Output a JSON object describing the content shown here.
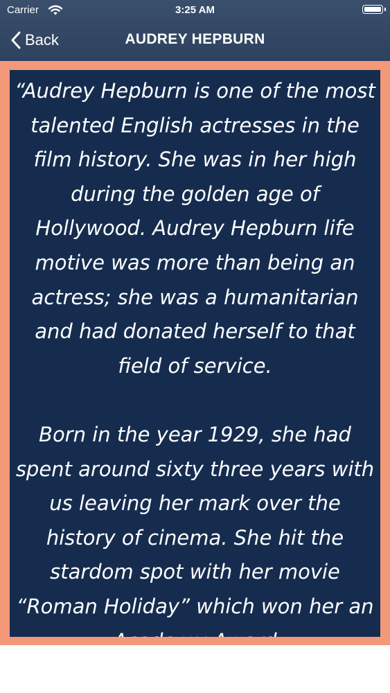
{
  "status_bar": {
    "carrier": "Carrier",
    "time": "3:25 AM",
    "wifi_icon": "wifi-icon",
    "battery_icon": "battery-icon"
  },
  "nav": {
    "back_label": "Back",
    "back_icon": "chevron-left-icon",
    "title": "AUDREY HEPBURN"
  },
  "colors": {
    "nav_bar": "#344966",
    "frame": "#f4987a",
    "panel": "#162c4f",
    "text": "#ffffff"
  },
  "content": {
    "paragraphs": [
      "“Audrey Hepburn is one of the most talented English actresses in the film history. She was in her high during the golden age of Hollywood. Audrey Hepburn life motive was more than being an actress; she was a humanitarian and had donated herself to that field of service.",
      "Born in the year 1929, she had spent around sixty three years with us leaving her mark over the history of cinema. She hit the stardom spot with her movie “Roman Holiday” which won her an Academy Award"
    ]
  }
}
